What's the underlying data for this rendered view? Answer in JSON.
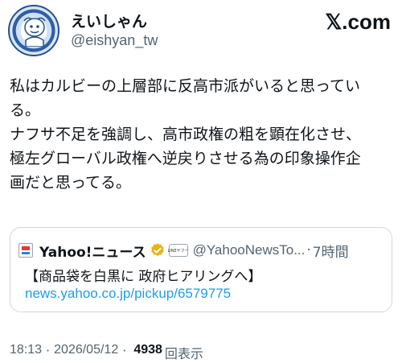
{
  "author": {
    "display_name": "えいしゃん",
    "handle": "@eishyan_tw",
    "avatar_icon": "avatar-illustration"
  },
  "brand": {
    "label": "𝕏.com"
  },
  "tweet": {
    "text": "私はカルビーの上層部に反高市派がいると思ってい\nる。\nナフサ不足を強調し、高市政権の粗を顕在化させ、\n極左グローバル政権へ逆戻りさせる為の印象操作企\n画だと思ってる。"
  },
  "quoted_card": {
    "source_name": "Yahoo!ニュース",
    "source_icon": "yahoo-news-icon",
    "verified_icon": "gold-verified-badge-icon",
    "affiliate_badge_text": "LINEヤフー",
    "handle": "@YahooNewsTo...",
    "separator": "·",
    "time_ago": "7時間",
    "headline": "【商品袋を白黒に 政府ヒアリングへ】",
    "link": "news.yahoo.co.jp/pickup/6579775"
  },
  "meta": {
    "time": "18:13",
    "separator": "·",
    "date": "2026/05/12",
    "views_count": "4938",
    "views_label": "回表示"
  },
  "colors": {
    "text": "#0f1419",
    "secondary": "#536471",
    "link": "#1d9bf0",
    "border": "#cfd9de",
    "verified_gold": "#e8b31a"
  }
}
